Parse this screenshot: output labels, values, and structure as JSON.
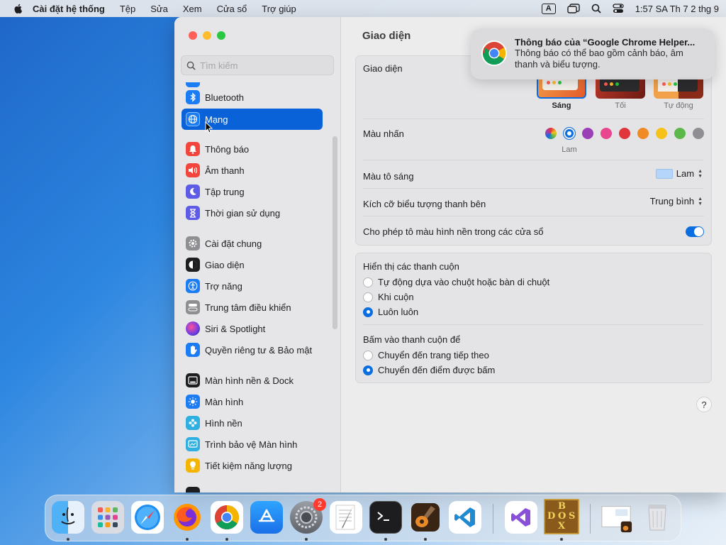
{
  "menubar": {
    "app_name": "Cài đặt hệ thống",
    "menus": [
      "Tệp",
      "Sửa",
      "Xem",
      "Cửa sổ",
      "Trợ giúp"
    ],
    "input_source": "A",
    "clock": "1:57 SA Th 7 2 thg 9"
  },
  "sidebar": {
    "search_placeholder": "Tìm kiếm",
    "items": [
      {
        "label": "Bluetooth",
        "icon": "bluetooth-icon",
        "color": "#1c7cf4"
      },
      {
        "label": "Mạng",
        "icon": "globe-icon",
        "color": "#1c7cf4"
      },
      {
        "label": "Thông báo",
        "icon": "bell-icon",
        "color": "#f2453d"
      },
      {
        "label": "Âm thanh",
        "icon": "speaker-icon",
        "color": "#f2453d"
      },
      {
        "label": "Tập trung",
        "icon": "moon-icon",
        "color": "#5e5ce6"
      },
      {
        "label": "Thời gian sử dụng",
        "icon": "hourglass-icon",
        "color": "#5e5ce6"
      },
      {
        "label": "Cài đặt chung",
        "icon": "gear-icon",
        "color": "#8e8e93"
      },
      {
        "label": "Giao diện",
        "icon": "appearance-icon",
        "color": "#1d1d1f"
      },
      {
        "label": "Trợ năng",
        "icon": "accessibility-icon",
        "color": "#1c7cf4"
      },
      {
        "label": "Trung tâm điều khiển",
        "icon": "control-center-icon",
        "color": "#8e8e93"
      },
      {
        "label": "Siri & Spotlight",
        "icon": "siri-icon",
        "color": "#a23bd8"
      },
      {
        "label": "Quyền riêng tư & Bảo mật",
        "icon": "hand-icon",
        "color": "#1c7cf4"
      },
      {
        "label": "Màn hình nền & Dock",
        "icon": "dock-icon",
        "color": "#1d1d1f"
      },
      {
        "label": "Màn hình",
        "icon": "sun-icon",
        "color": "#1c7cf4"
      },
      {
        "label": "Hình nền",
        "icon": "flower-icon",
        "color": "#30b0e0"
      },
      {
        "label": "Trình bảo vệ Màn hình",
        "icon": "screensaver-icon",
        "color": "#30b0e0"
      },
      {
        "label": "Tiết kiệm năng lượng",
        "icon": "bulb-icon",
        "color": "#f5b400"
      }
    ]
  },
  "content": {
    "title": "Giao diện",
    "appearance_label": "Giao diện",
    "themes": [
      {
        "label": "Sáng",
        "selected": true
      },
      {
        "label": "Tối",
        "selected": false
      },
      {
        "label": "Tự động",
        "selected": false
      }
    ],
    "accent_label": "Màu nhấn",
    "accent_selected_name": "Lam",
    "accent_colors": [
      "#0a6ee0",
      "#9a3fb5",
      "#e8468f",
      "#e0353b",
      "#f08a24",
      "#f6c21a",
      "#5cb84a",
      "#8e8e93"
    ],
    "highlight_label": "Màu tô sáng",
    "highlight_value": "Lam",
    "highlight_swatch": "#b5d5fb",
    "sidebar_icon_size_label": "Kích cỡ biểu tượng thanh bên",
    "sidebar_icon_size_value": "Trung bình",
    "wallpaper_tint_label": "Cho phép tô màu hình nền trong các cửa sổ",
    "wallpaper_tint_on": true,
    "show_scrollbars_label": "Hiển thị các thanh cuộn",
    "show_scrollbars_options": [
      {
        "label": "Tự động dựa vào chuột hoặc bàn di chuột",
        "checked": false
      },
      {
        "label": "Khi cuộn",
        "checked": false
      },
      {
        "label": "Luôn luôn",
        "checked": true
      }
    ],
    "click_scrollbar_label": "Bấm vào thanh cuộn để",
    "click_scrollbar_options": [
      {
        "label": "Chuyển đến trang tiếp theo",
        "checked": false
      },
      {
        "label": "Chuyển đến điểm được bấm",
        "checked": true
      }
    ],
    "help": "?"
  },
  "notification": {
    "title": "Thông báo của “Google Chrome Helper...",
    "body": "Thông báo có thể bao gồm cảnh báo, âm thanh và biểu tượng."
  },
  "dock": {
    "badge": "2",
    "dosbox_letters": [
      "B",
      "D",
      "O",
      "S",
      "X"
    ]
  }
}
